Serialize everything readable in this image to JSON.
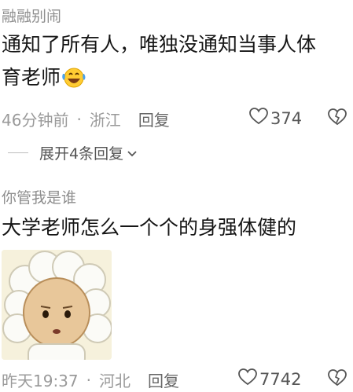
{
  "comments": [
    {
      "username": "融融别闹",
      "text_line1": "通知了所有人，唯独没通知当事人体",
      "text_line2": "育老师",
      "emoji": "laughing-tears-emoji",
      "time": "46分钟前",
      "location": "浙江",
      "reply_label": "回复",
      "likes": "374",
      "expand_label": "展开4条回复"
    },
    {
      "username": "你管我是谁",
      "text": "大学老师怎么一个个的身强体健的",
      "sticker": "pleasant-goat-slow-goat-sticker",
      "time": "昨天19:37",
      "location": "河北",
      "reply_label": "回复",
      "likes": "7742"
    }
  ],
  "separator": "·",
  "colors": {
    "muted_text": "#9a9a9a",
    "username": "#8e8e8e",
    "body_text": "#161616"
  }
}
